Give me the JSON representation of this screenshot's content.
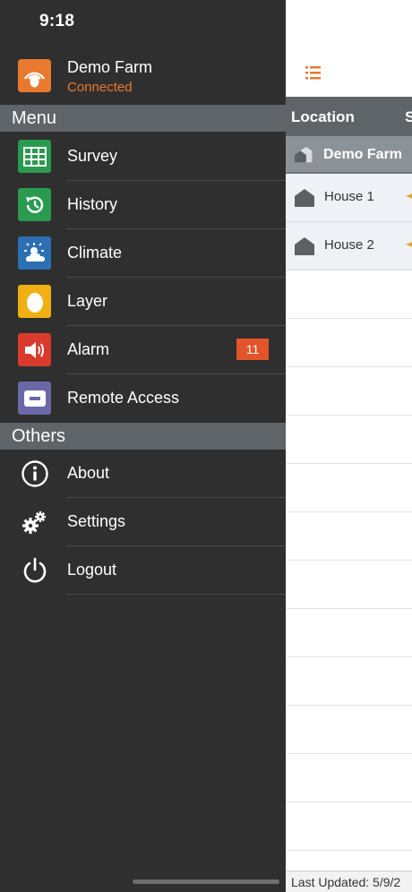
{
  "status_bar": {
    "time": "9:18"
  },
  "farm": {
    "name": "Demo Farm",
    "status": "Connected",
    "icon": "egg-signal-icon"
  },
  "menu_section": "Menu",
  "menu_items": [
    {
      "label": "Survey",
      "icon": "grid-table-icon",
      "color": "#2a9a4f"
    },
    {
      "label": "History",
      "icon": "history-clock-icon",
      "color": "#2a9a4f"
    },
    {
      "label": "Climate",
      "icon": "sun-cloud-icon",
      "color": "#2d6fb3"
    },
    {
      "label": "Layer",
      "icon": "egg-icon",
      "color": "#f0b014"
    },
    {
      "label": "Alarm",
      "icon": "speaker-icon",
      "color": "#d83a2c",
      "badge": "11"
    },
    {
      "label": "Remote Access",
      "icon": "remote-access-icon",
      "color": "#6b68a8"
    }
  ],
  "others_section": "Others",
  "others_items": [
    {
      "label": "About",
      "icon": "info-icon"
    },
    {
      "label": "Settings",
      "icon": "gears-icon"
    },
    {
      "label": "Logout",
      "icon": "power-icon"
    }
  ],
  "main": {
    "list_icon": "list-icon",
    "table_header": {
      "location": "Location",
      "second_col": "S"
    },
    "farm_row": {
      "label": "Demo Farm"
    },
    "houses": [
      {
        "label": "House 1"
      },
      {
        "label": "House 2"
      }
    ],
    "footer": "Last Updated: 5/9/2"
  },
  "colors": {
    "accent": "#e8792e",
    "drawer_bg": "#2f2f2f",
    "header_bg": "#5f6468",
    "badge": "#e2542a"
  }
}
